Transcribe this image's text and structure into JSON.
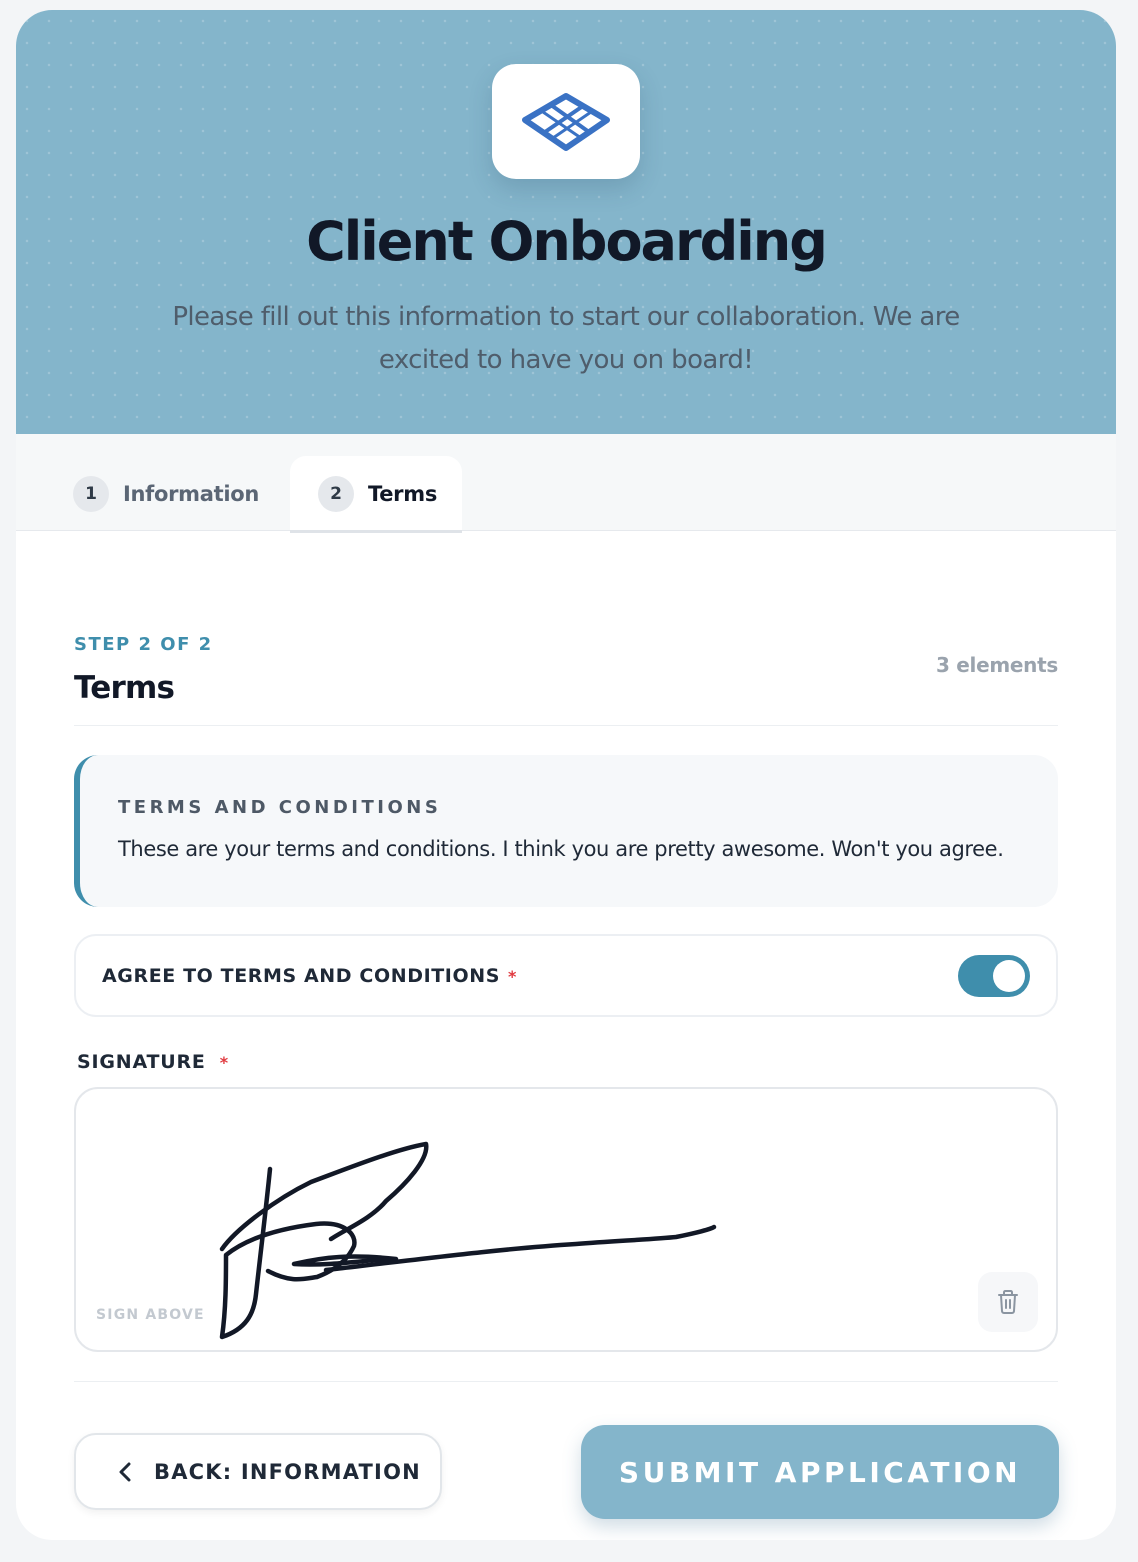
{
  "header": {
    "logo": "grid-diamond-logo-icon",
    "title": "Client Onboarding",
    "subtitle": "Please fill out this information to start our collaboration. We are excited to have you on board!"
  },
  "tabs": [
    {
      "number": "1",
      "label": "Information",
      "active": false
    },
    {
      "number": "2",
      "label": "Terms",
      "active": true
    }
  ],
  "section": {
    "step": "STEP 2 OF 2",
    "title": "Terms",
    "count": "3 elements"
  },
  "terms": {
    "heading": "TERMS AND CONDITIONS",
    "text": "These are your terms and conditions. I think you are pretty awesome. Won't you agree."
  },
  "agree": {
    "label": "AGREE TO TERMS AND CONDITIONS",
    "required": "*",
    "checked": true
  },
  "signature": {
    "label": "SIGNATURE",
    "required": "*",
    "hint": "SIGN ABOVE",
    "clear_icon": "trash-icon"
  },
  "actions": {
    "back_icon": "chevron-left-icon",
    "back_label": "BACK: INFORMATION",
    "submit_label": "SUBMIT APPLICATION"
  },
  "colors": {
    "header_bg": "#84b5cb",
    "accent": "#3f8eac",
    "required": "#e0393f",
    "logo": "#3a72c4"
  }
}
